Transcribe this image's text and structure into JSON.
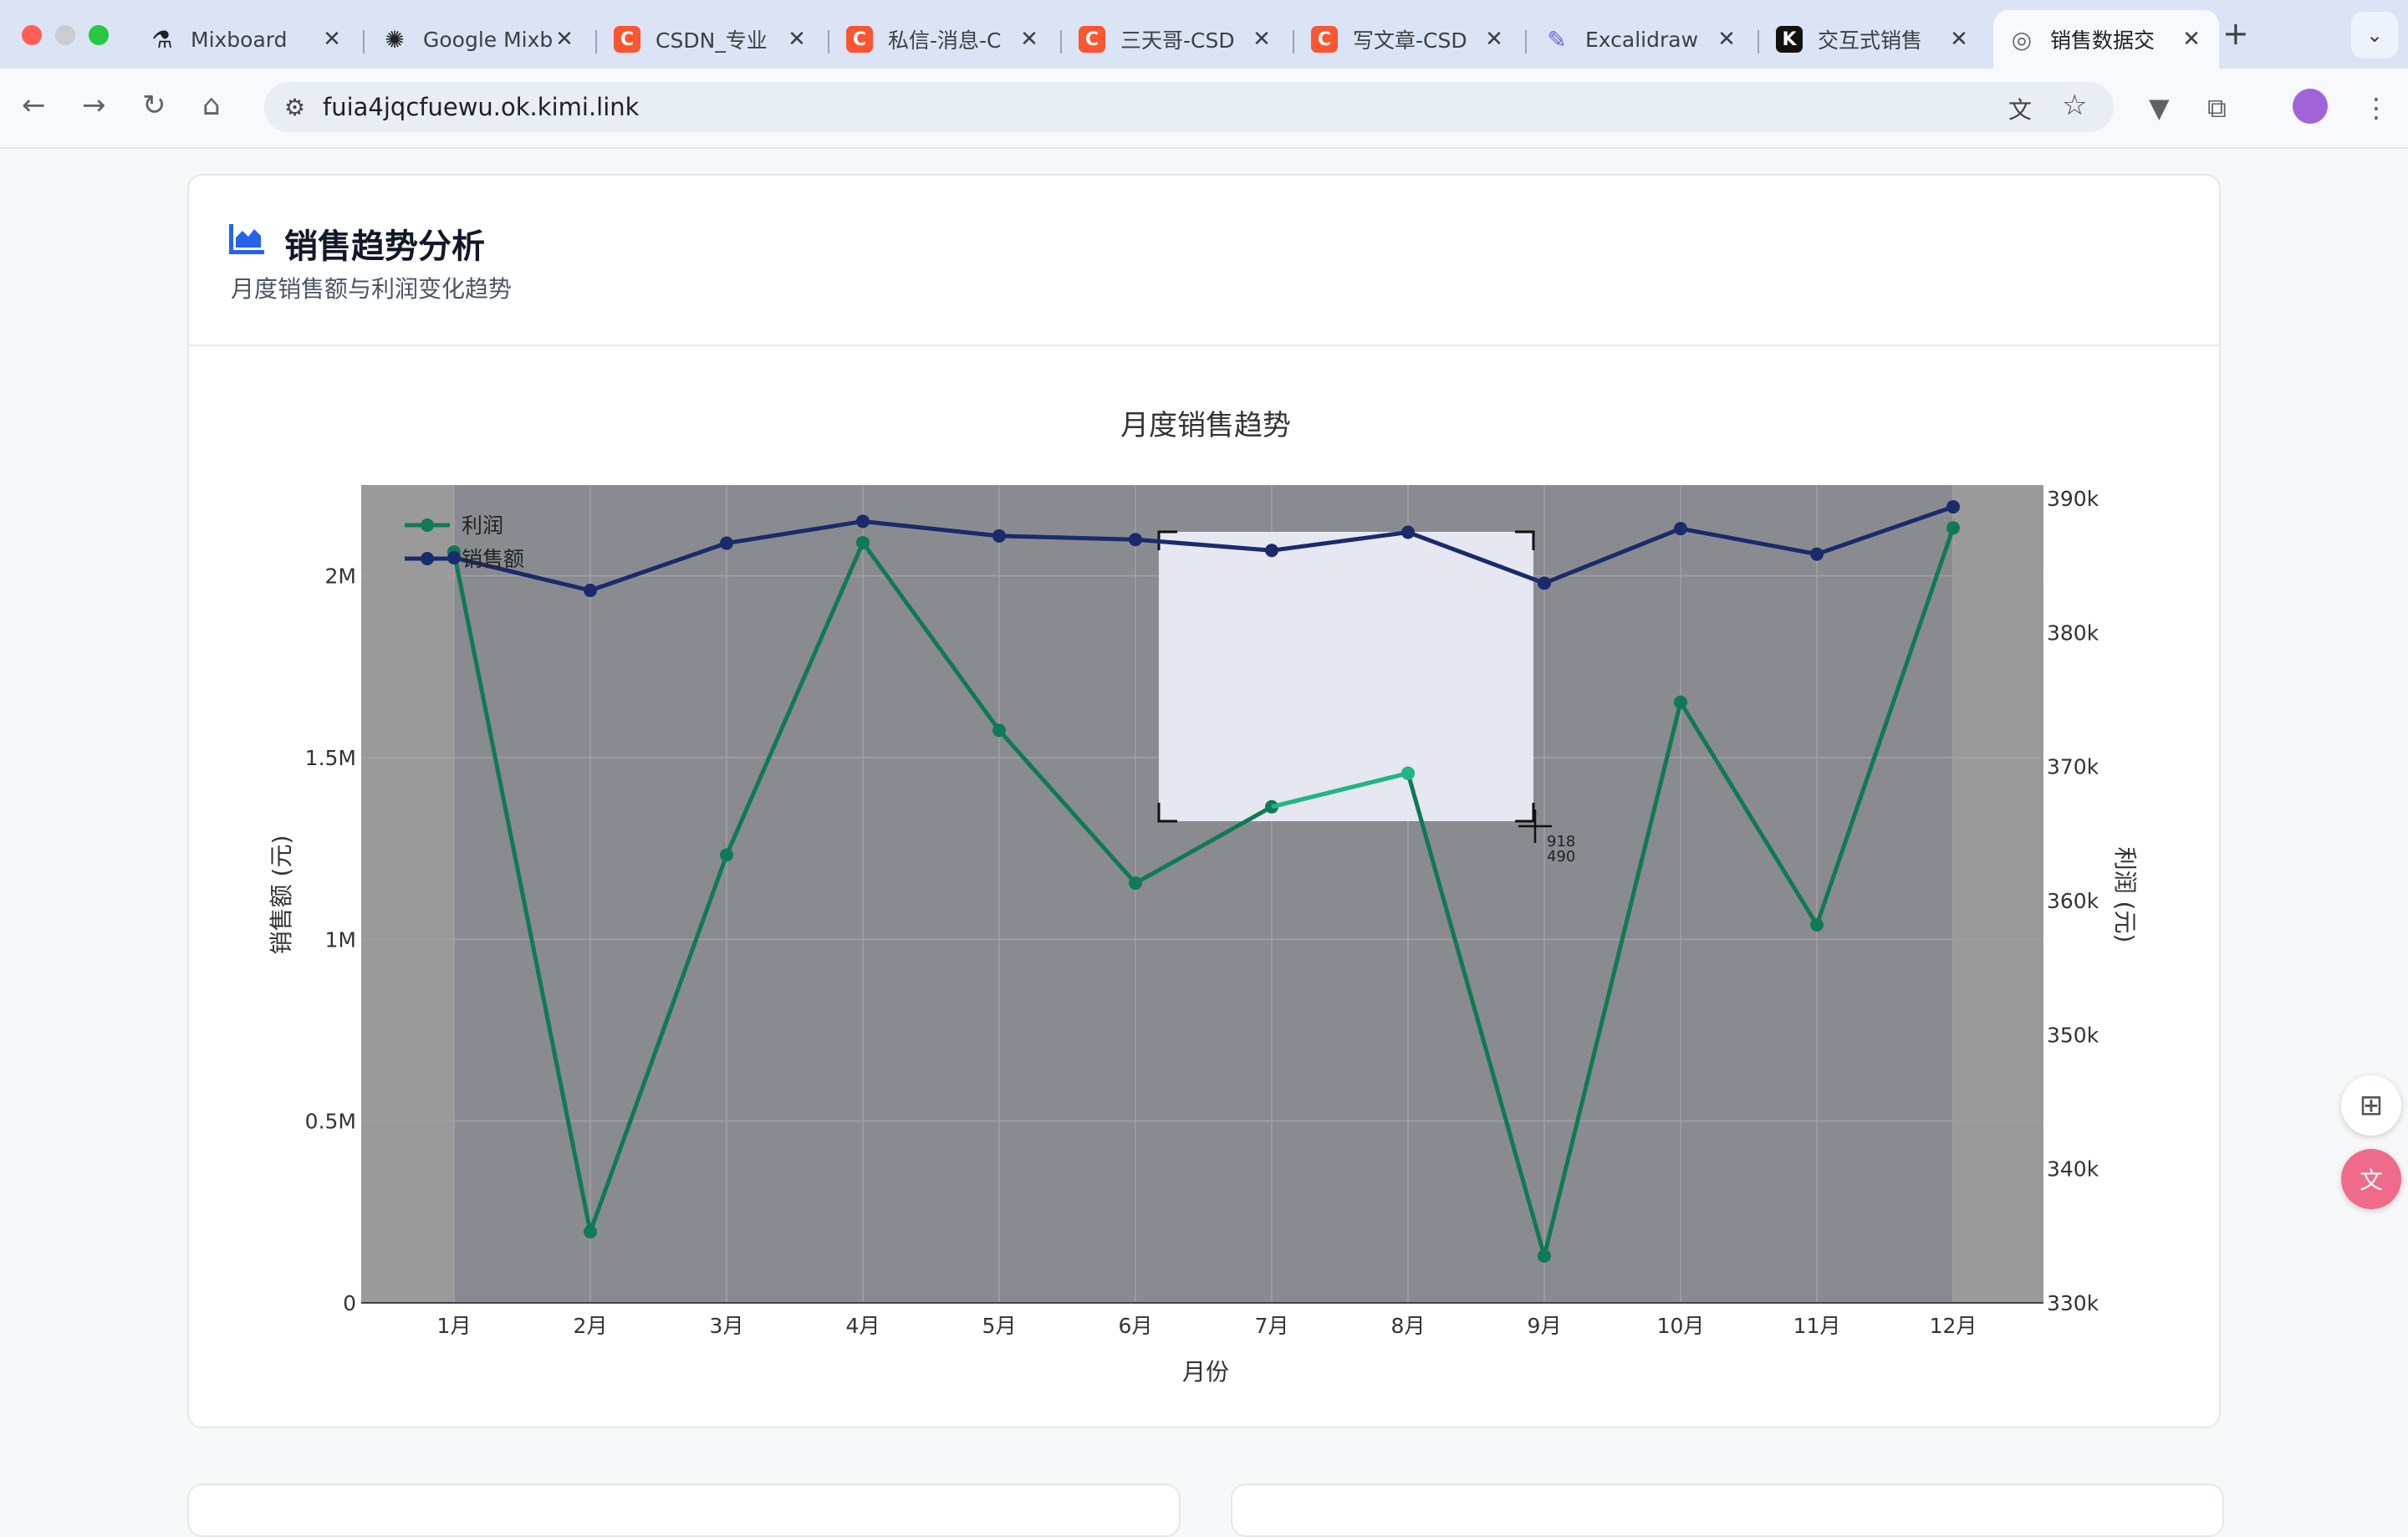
{
  "browser": {
    "tabs": [
      {
        "title": "Mixboard",
        "icon": "flask-icon",
        "color": "#202124"
      },
      {
        "title": "Google Mixb",
        "icon": "openai-icon",
        "color": "#202124"
      },
      {
        "title": "CSDN_专业",
        "icon": "csdn-icon",
        "color": "#fc5531"
      },
      {
        "title": "私信-消息-C",
        "icon": "csdn-icon",
        "color": "#fc5531"
      },
      {
        "title": "三天哥-CSD",
        "icon": "csdn-icon",
        "color": "#fc5531"
      },
      {
        "title": "写文章-CSD",
        "icon": "csdn-icon",
        "color": "#fc5531"
      },
      {
        "title": "Excalidraw",
        "icon": "excalidraw-icon",
        "color": "#6965db"
      },
      {
        "title": "交互式销售",
        "icon": "kimi-icon",
        "color": "#111111"
      },
      {
        "title": "销售数据交",
        "icon": "globe-icon",
        "color": "#5f6368",
        "active": true
      }
    ],
    "url": "fuia4jqcfuewu.ok.kimi.link"
  },
  "card": {
    "title": "销售趋势分析",
    "subtitle": "月度销售额与利润变化趋势"
  },
  "cursor_readout": {
    "x": "918",
    "y": "490"
  },
  "chart_data": {
    "type": "line",
    "title": "月度销售趋势",
    "xlabel": "月份",
    "ylabel": "销售额 (元)",
    "y2label": "利润 (元)",
    "categories": [
      "1月",
      "2月",
      "3月",
      "4月",
      "5月",
      "6月",
      "7月",
      "8月",
      "9月",
      "10月",
      "11月",
      "12月"
    ],
    "ylim": [
      0,
      2250000
    ],
    "y2lim": [
      330000,
      391000
    ],
    "yticks": [
      {
        "v": 0,
        "label": "0"
      },
      {
        "v": 500000,
        "label": "0.5M"
      },
      {
        "v": 1000000,
        "label": "1M"
      },
      {
        "v": 1500000,
        "label": "1.5M"
      },
      {
        "v": 2000000,
        "label": "2M"
      }
    ],
    "y2ticks": [
      {
        "v": 330000,
        "label": "330k"
      },
      {
        "v": 340000,
        "label": "340k"
      },
      {
        "v": 350000,
        "label": "350k"
      },
      {
        "v": 360000,
        "label": "360k"
      },
      {
        "v": 370000,
        "label": "370k"
      },
      {
        "v": 380000,
        "label": "380k"
      },
      {
        "v": 390000,
        "label": "390k"
      }
    ],
    "legend_position": "top-left",
    "grid": true,
    "series": [
      {
        "name": "利润",
        "axis": "right",
        "color": "#0f7a55",
        "values": [
          386000,
          335300,
          363400,
          386700,
          372700,
          361300,
          367000,
          369500,
          333500,
          374800,
          358200,
          387800
        ]
      },
      {
        "name": "销售额",
        "axis": "left",
        "color": "#1b2a6b",
        "values": [
          2050000,
          1960000,
          2090000,
          2150000,
          2110000,
          2100000,
          2070000,
          2120000,
          1980000,
          2130000,
          2060000,
          2190000
        ]
      }
    ]
  }
}
